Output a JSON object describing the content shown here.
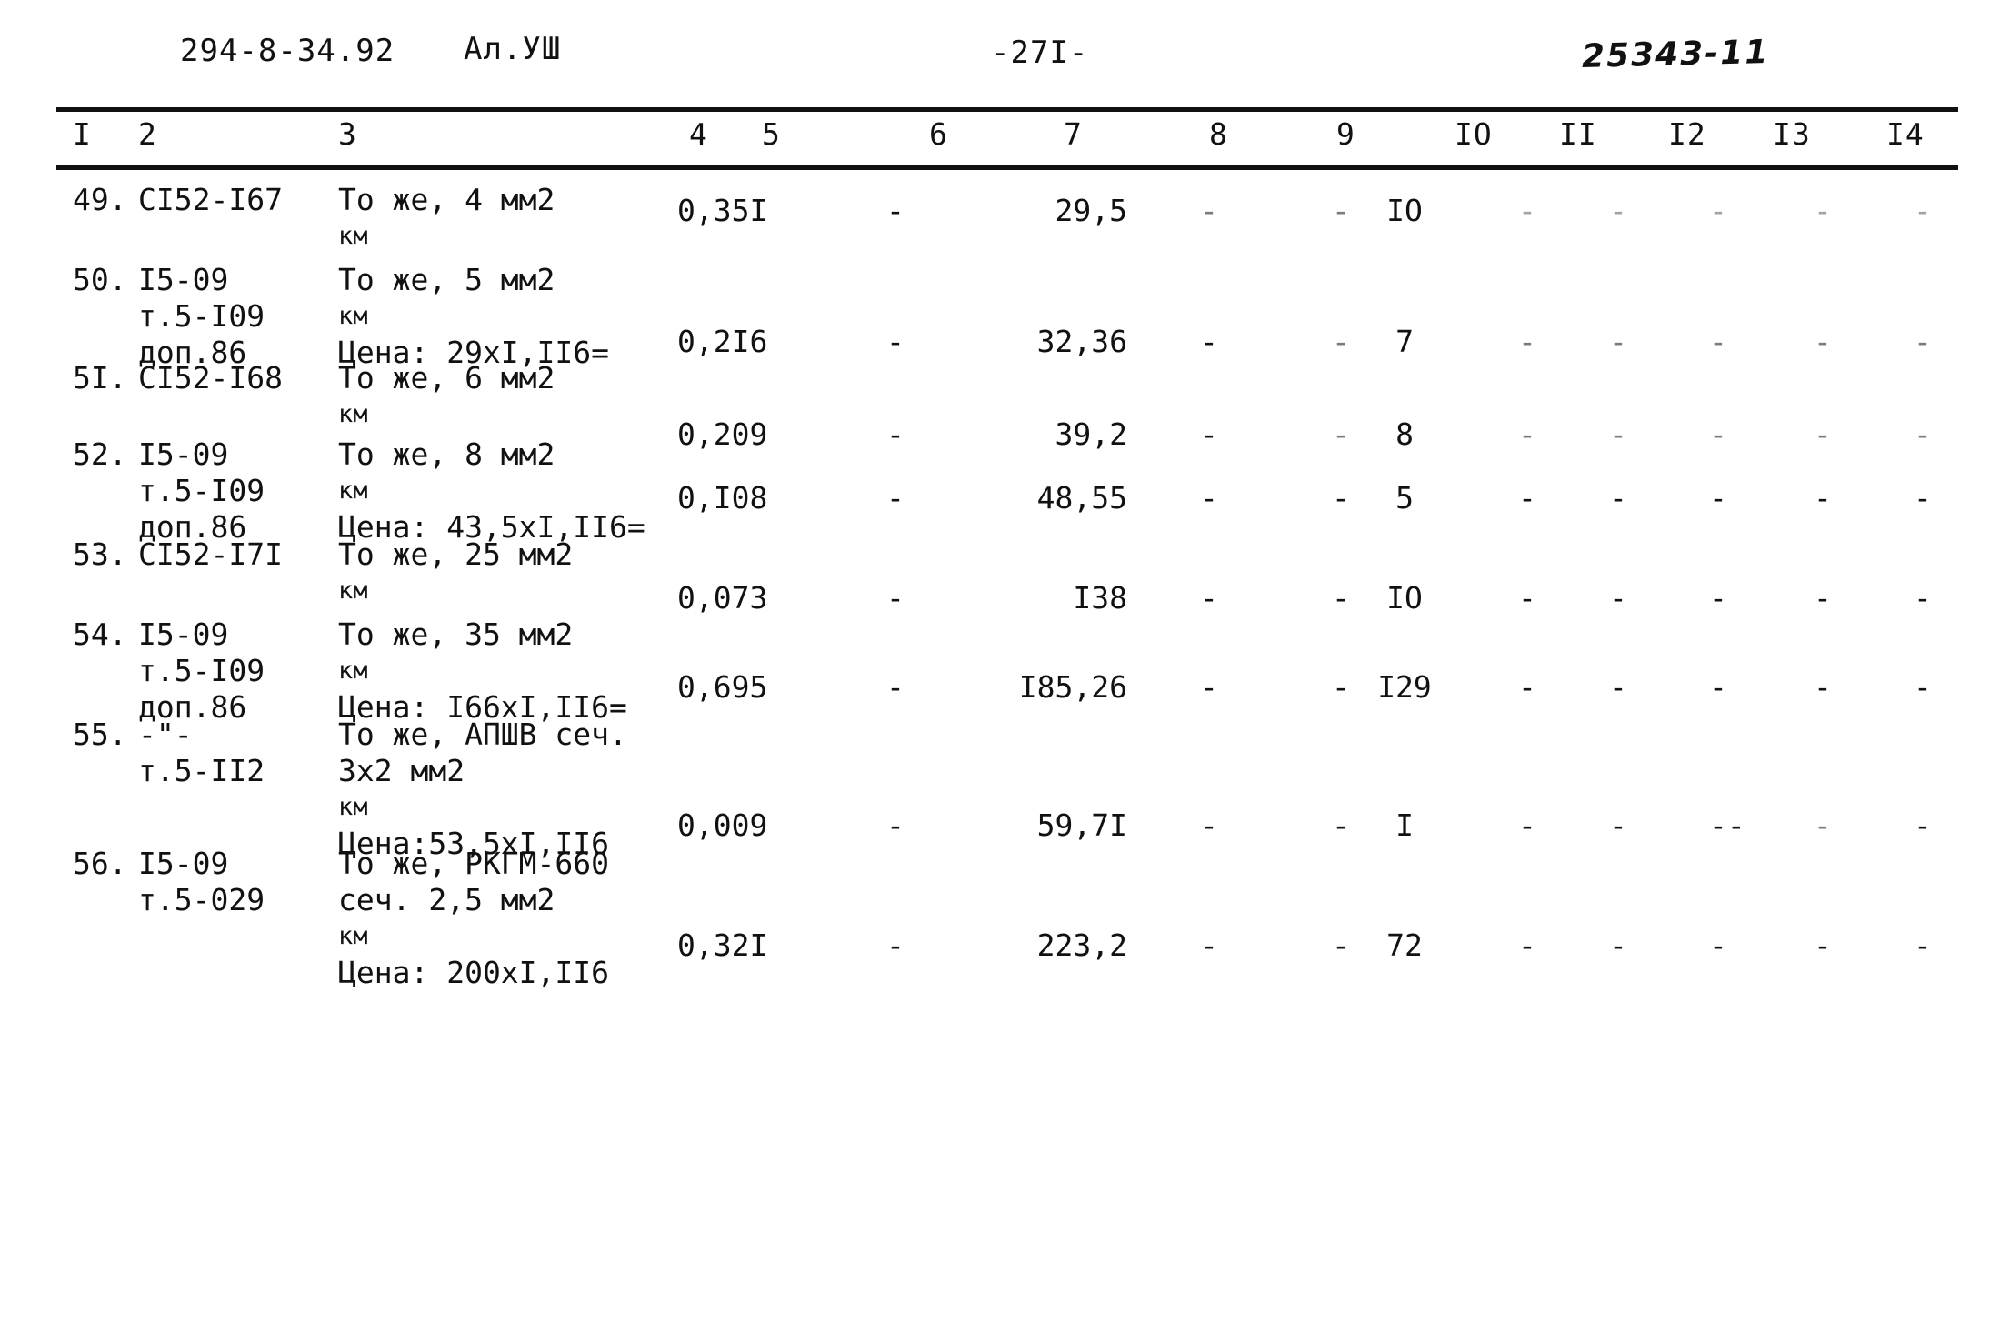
{
  "header": {
    "doc_code": "294-8-34.92",
    "album": "Ал.УШ",
    "page_number": "-27I-",
    "stamp": "25343-11"
  },
  "table": {
    "column_headers": [
      "I",
      "2",
      "3",
      "4",
      "5",
      "6",
      "7",
      "8",
      "9",
      "IO",
      "II",
      "I2",
      "I3",
      "I4"
    ],
    "rows": [
      {
        "no": "49.",
        "code": "CI52-I67",
        "desc": "То же, 4 мм2\nкм",
        "c4": "0,35I",
        "c5": "-",
        "c6": "29,5",
        "c7": "-",
        "c8": "-",
        "c9": "IO",
        "c10": "-",
        "c11": "-",
        "c12": "-",
        "c13": "-",
        "c14": "-"
      },
      {
        "no": "50.",
        "code": "I5-09\nт.5-I09\nдоп.86",
        "desc": "То же, 5 мм2\nкм\nЦена: 29xI,II6=",
        "c4": "0,2I6",
        "c5": "-",
        "c6": "32,36",
        "c7": "-",
        "c8": "-",
        "c9": "7",
        "c10": "-",
        "c11": "-",
        "c12": "-",
        "c13": "-",
        "c14": "-"
      },
      {
        "no": "5I.",
        "code": "CI52-I68",
        "desc": "То же, 6 мм2\nкм",
        "c4": "0,209",
        "c5": "-",
        "c6": "39,2",
        "c7": "-",
        "c8": "-",
        "c9": "8",
        "c10": "-",
        "c11": "-",
        "c12": "-",
        "c13": "-",
        "c14": "-"
      },
      {
        "no": "52.",
        "code": "I5-09\nт.5-I09\nдоп.86",
        "desc": "То же, 8 мм2\nкм\nЦена: 43,5xI,II6=",
        "c4": "0,I08",
        "c5": "-",
        "c6": "48,55",
        "c7": "-",
        "c8": "-",
        "c9": "5",
        "c10": "-",
        "c11": "-",
        "c12": "-",
        "c13": "-",
        "c14": "-"
      },
      {
        "no": "53.",
        "code": "CI52-I7I",
        "desc": "То же, 25 мм2\nкм",
        "c4": "0,073",
        "c5": "-",
        "c6": "I38",
        "c7": "-",
        "c8": "-",
        "c9": "IO",
        "c10": "-",
        "c11": "-",
        "c12": "-",
        "c13": "-",
        "c14": "-"
      },
      {
        "no": "54.",
        "code": "I5-09\nт.5-I09\nдоп.86",
        "desc": "То же, 35 мм2\nкм\nЦена: I66xI,II6=",
        "c4": "0,695",
        "c5": "-",
        "c6": "I85,26",
        "c7": "-",
        "c8": "-",
        "c9": "I29",
        "c10": "-",
        "c11": "-",
        "c12": "-",
        "c13": "-",
        "c14": "-"
      },
      {
        "no": "55.",
        "code": "-\"-\nт.5-II2",
        "desc": "То же, АПШВ сеч.\n3x2 мм2\nкм\nЦена:53,5xI,II6",
        "c4": "0,009",
        "c5": "-",
        "c6": "59,7I",
        "c7": "-",
        "c8": "-",
        "c9": "I",
        "c10": "-",
        "c11": "-",
        "c12": "--",
        "c13": "-",
        "c14": "-"
      },
      {
        "no": "56.",
        "code": "I5-09\nт.5-029",
        "desc": "То же, РКГМ-660\nсеч. 2,5 мм2\nкм\nЦена: 200xI,II6",
        "c4": "0,32I",
        "c5": "-",
        "c6": "223,2",
        "c7": "-",
        "c8": "-",
        "c9": "72",
        "c10": "-",
        "c11": "-",
        "c12": "-",
        "c13": "-",
        "c14": "-"
      }
    ]
  }
}
